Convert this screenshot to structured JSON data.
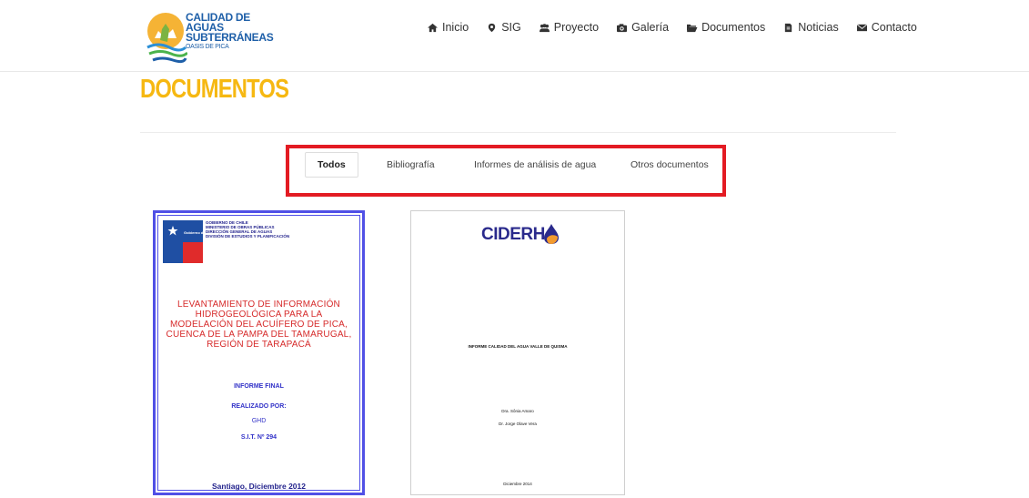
{
  "brand": {
    "line1": "CALIDAD DE AGUAS",
    "line2": "SUBTERRÁNEAS",
    "line3": "OASIS DE PICA",
    "colors": {
      "title": "#f6b812",
      "highlight": "#e31b23",
      "logo_text": "#1e5fa8"
    }
  },
  "nav": [
    {
      "label": "Inicio",
      "icon": "home-icon"
    },
    {
      "label": "SIG",
      "icon": "map-marker-icon"
    },
    {
      "label": "Proyecto",
      "icon": "users-icon"
    },
    {
      "label": "Galería",
      "icon": "camera-icon"
    },
    {
      "label": "Documentos",
      "icon": "folder-icon"
    },
    {
      "label": "Noticias",
      "icon": "file-icon"
    },
    {
      "label": "Contacto",
      "icon": "envelope-icon"
    }
  ],
  "page": {
    "title": "DOCUMENTOS"
  },
  "filters": {
    "tabs": [
      "Todos",
      "Bibliografía",
      "Informes de análisis de agua",
      "Otros documentos"
    ],
    "active": "Todos"
  },
  "documents": [
    {
      "header": [
        "GOBIERNO DE CHILE",
        "MINISTERIO DE OBRAS PÚBLICAS",
        "DIRECCIÓN GENERAL DE AGUAS",
        "DIVISIÓN DE ESTUDIOS Y PLANIFICACIÓN"
      ],
      "flag_text": "Gobierno de Chile",
      "title": "LEVANTAMIENTO DE INFORMACIÓN HIDROGEOLÓGICA PARA LA MODELACIÓN DEL ACUÍFERO DE PICA, CUENCA DE LA PAMPA DEL TAMARUGAL, REGIÓN DE TARAPACÁ",
      "report": "INFORME FINAL",
      "made_by": "REALIZADO POR:",
      "author": "GHD",
      "sit": "S.I.T. Nº 294",
      "date": "Santiago, Diciembre 2012"
    },
    {
      "logo": "CIDERH",
      "title": "INFORME CALIDAD DEL AGUA VALLE DE QUISMA",
      "author1": "Dra. Sônia Amaro",
      "author2": "Dr. Jorge Olave Vera",
      "date": "Diciembre 2014"
    }
  ]
}
